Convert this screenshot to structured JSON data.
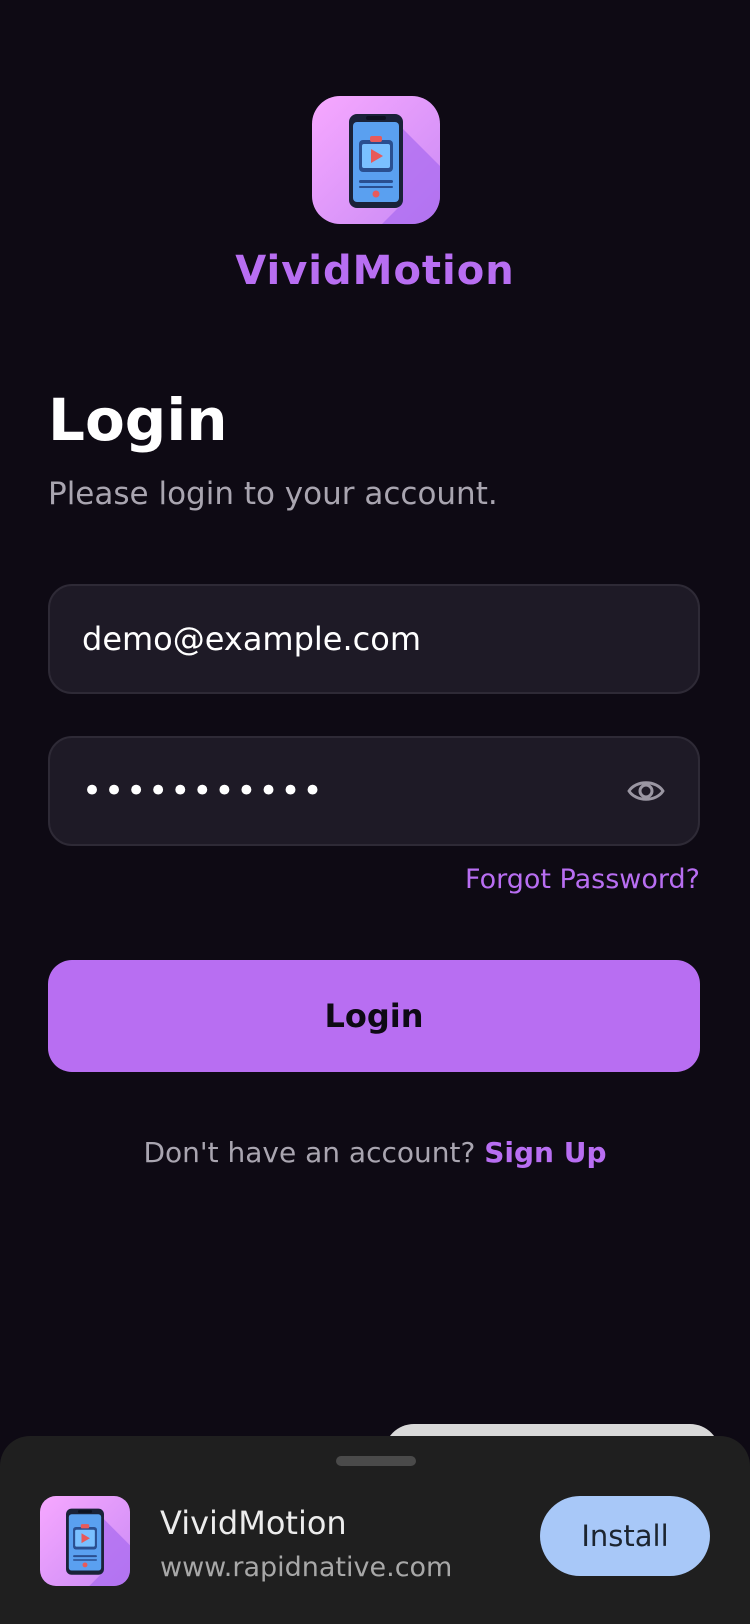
{
  "app": {
    "name": "VividMotion",
    "logo_icon": "phone-play-icon"
  },
  "login": {
    "title": "Login",
    "subtitle": "Please login to your account.",
    "email_value": "demo@example.com",
    "password_value": "•••••••••••",
    "password_toggle_icon": "eye-icon",
    "forgot_label": "Forgot Password?",
    "submit_label": "Login",
    "signup_prompt": "Don't have an account?",
    "signup_link": "Sign Up"
  },
  "install_banner": {
    "app_name": "VividMotion",
    "url": "www.rapidnative.com",
    "install_label": "Install"
  },
  "colors": {
    "background": "#0e0a14",
    "accent": "#b86ef2",
    "field_bg": "#1e1a26",
    "install_button": "#a8c8f8"
  }
}
